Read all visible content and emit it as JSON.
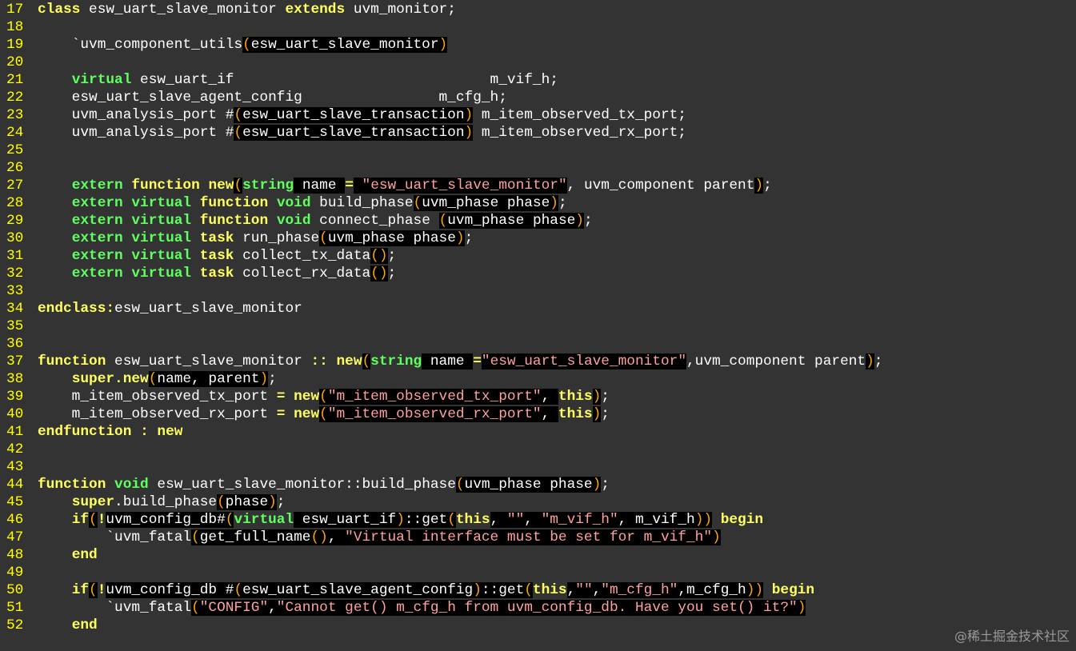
{
  "editor": {
    "lines": [
      {
        "n": "17",
        "tokens": [
          [
            "kw-y",
            "class"
          ],
          [
            "plain",
            " esw_uart_slave_monitor "
          ],
          [
            "kw-y",
            "extends"
          ],
          [
            "plain",
            " uvm_monitor;"
          ]
        ]
      },
      {
        "n": "18",
        "tokens": []
      },
      {
        "n": "19",
        "tokens": [
          [
            "plain",
            "    `uvm_component_utils"
          ],
          [
            "paren",
            "("
          ],
          [
            "dark",
            "esw_uart_slave_monitor"
          ],
          [
            "paren",
            ")"
          ]
        ]
      },
      {
        "n": "20",
        "tokens": []
      },
      {
        "n": "21",
        "tokens": [
          [
            "plain",
            "    "
          ],
          [
            "kw-g",
            "virtual"
          ],
          [
            "plain",
            " esw_uart_if                              m_vif_h;"
          ]
        ]
      },
      {
        "n": "22",
        "tokens": [
          [
            "plain",
            "    esw_uart_slave_agent_config                m_cfg_h;"
          ]
        ]
      },
      {
        "n": "23",
        "tokens": [
          [
            "plain",
            "    uvm_analysis_port #"
          ],
          [
            "paren",
            "("
          ],
          [
            "dark",
            "esw_uart_slave_transaction"
          ],
          [
            "paren",
            ")"
          ],
          [
            "plain",
            " m_item_observed_tx_port;"
          ]
        ]
      },
      {
        "n": "24",
        "tokens": [
          [
            "plain",
            "    uvm_analysis_port #"
          ],
          [
            "paren",
            "("
          ],
          [
            "dark",
            "esw_uart_slave_transaction"
          ],
          [
            "paren",
            ")"
          ],
          [
            "plain",
            " m_item_observed_rx_port;"
          ]
        ]
      },
      {
        "n": "25",
        "tokens": []
      },
      {
        "n": "26",
        "tokens": []
      },
      {
        "n": "27",
        "tokens": [
          [
            "plain",
            "    "
          ],
          [
            "kw-g",
            "extern"
          ],
          [
            "plain",
            " "
          ],
          [
            "kw-y",
            "function"
          ],
          [
            "plain",
            " "
          ],
          [
            "kw-y",
            "new"
          ],
          [
            "paren",
            "("
          ],
          [
            "kw-g",
            "string"
          ],
          [
            "dark",
            " name "
          ],
          [
            "op",
            "="
          ],
          [
            "dark",
            " "
          ],
          [
            "str",
            "\"esw_uart_slave_monitor\""
          ],
          [
            "plain",
            ", uvm_component parent"
          ],
          [
            "paren",
            ")"
          ],
          [
            "plain",
            ";"
          ]
        ]
      },
      {
        "n": "28",
        "tokens": [
          [
            "plain",
            "    "
          ],
          [
            "kw-g",
            "extern"
          ],
          [
            "plain",
            " "
          ],
          [
            "kw-g",
            "virtual"
          ],
          [
            "plain",
            " "
          ],
          [
            "kw-y",
            "function"
          ],
          [
            "plain",
            " "
          ],
          [
            "kw-g",
            "void"
          ],
          [
            "plain",
            " build_phase"
          ],
          [
            "paren",
            "("
          ],
          [
            "dark",
            "uvm_phase phase"
          ],
          [
            "paren",
            ")"
          ],
          [
            "plain",
            ";"
          ]
        ]
      },
      {
        "n": "29",
        "tokens": [
          [
            "plain",
            "    "
          ],
          [
            "kw-g",
            "extern"
          ],
          [
            "plain",
            " "
          ],
          [
            "kw-g",
            "virtual"
          ],
          [
            "plain",
            " "
          ],
          [
            "kw-y",
            "function"
          ],
          [
            "plain",
            " "
          ],
          [
            "kw-g",
            "void"
          ],
          [
            "plain",
            " connect_phase "
          ],
          [
            "paren",
            "("
          ],
          [
            "dark",
            "uvm_phase phase"
          ],
          [
            "paren",
            ")"
          ],
          [
            "plain",
            ";"
          ]
        ]
      },
      {
        "n": "30",
        "tokens": [
          [
            "plain",
            "    "
          ],
          [
            "kw-g",
            "extern"
          ],
          [
            "plain",
            " "
          ],
          [
            "kw-g",
            "virtual"
          ],
          [
            "plain",
            " "
          ],
          [
            "kw-y",
            "task"
          ],
          [
            "plain",
            " run_phase"
          ],
          [
            "paren",
            "("
          ],
          [
            "dark",
            "uvm_phase phase"
          ],
          [
            "paren",
            ")"
          ],
          [
            "plain",
            ";"
          ]
        ]
      },
      {
        "n": "31",
        "tokens": [
          [
            "plain",
            "    "
          ],
          [
            "kw-g",
            "extern"
          ],
          [
            "plain",
            " "
          ],
          [
            "kw-g",
            "virtual"
          ],
          [
            "plain",
            " "
          ],
          [
            "kw-y",
            "task"
          ],
          [
            "plain",
            " collect_tx_data"
          ],
          [
            "paren",
            "()"
          ],
          [
            "plain",
            ";"
          ]
        ]
      },
      {
        "n": "32",
        "tokens": [
          [
            "plain",
            "    "
          ],
          [
            "kw-g",
            "extern"
          ],
          [
            "plain",
            " "
          ],
          [
            "kw-g",
            "virtual"
          ],
          [
            "plain",
            " "
          ],
          [
            "kw-y",
            "task"
          ],
          [
            "plain",
            " collect_rx_data"
          ],
          [
            "paren",
            "()"
          ],
          [
            "plain",
            ";"
          ]
        ]
      },
      {
        "n": "33",
        "tokens": []
      },
      {
        "n": "34",
        "tokens": [
          [
            "kw-y",
            "endclass"
          ],
          [
            "op",
            ":"
          ],
          [
            "plain",
            "esw_uart_slave_monitor"
          ]
        ]
      },
      {
        "n": "35",
        "tokens": []
      },
      {
        "n": "36",
        "tokens": []
      },
      {
        "n": "37",
        "tokens": [
          [
            "kw-y",
            "function"
          ],
          [
            "plain",
            " esw_uart_slave_monitor "
          ],
          [
            "op",
            "::"
          ],
          [
            "plain",
            " "
          ],
          [
            "kw-y",
            "new"
          ],
          [
            "paren",
            "("
          ],
          [
            "kw-g",
            "string"
          ],
          [
            "dark",
            " name "
          ],
          [
            "op",
            "="
          ],
          [
            "str",
            "\"esw_uart_slave_monitor\""
          ],
          [
            "plain",
            ",uvm_component parent"
          ],
          [
            "paren",
            ")"
          ],
          [
            "plain",
            ";"
          ]
        ]
      },
      {
        "n": "38",
        "tokens": [
          [
            "plain",
            "    "
          ],
          [
            "kw-y",
            "super"
          ],
          [
            "op",
            "."
          ],
          [
            "kw-y",
            "new"
          ],
          [
            "paren",
            "("
          ],
          [
            "dark",
            "name, parent"
          ],
          [
            "paren",
            ")"
          ],
          [
            "plain",
            ";"
          ]
        ]
      },
      {
        "n": "39",
        "tokens": [
          [
            "plain",
            "    m_item_observed_tx_port "
          ],
          [
            "op",
            "="
          ],
          [
            "plain",
            " "
          ],
          [
            "kw-y",
            "new"
          ],
          [
            "paren",
            "("
          ],
          [
            "str",
            "\"m_item_observed_tx_port\""
          ],
          [
            "dark",
            ", "
          ],
          [
            "kw-y",
            "this"
          ],
          [
            "paren",
            ")"
          ],
          [
            "plain",
            ";"
          ]
        ]
      },
      {
        "n": "40",
        "tokens": [
          [
            "plain",
            "    m_item_observed_rx_port "
          ],
          [
            "op",
            "="
          ],
          [
            "plain",
            " "
          ],
          [
            "kw-y",
            "new"
          ],
          [
            "paren",
            "("
          ],
          [
            "str",
            "\"m_item_observed_rx_port\""
          ],
          [
            "dark",
            ", "
          ],
          [
            "kw-y",
            "this"
          ],
          [
            "paren",
            ")"
          ],
          [
            "plain",
            ";"
          ]
        ]
      },
      {
        "n": "41",
        "tokens": [
          [
            "kw-y",
            "endfunction"
          ],
          [
            "plain",
            " "
          ],
          [
            "op",
            ":"
          ],
          [
            "plain",
            " "
          ],
          [
            "kw-y",
            "new"
          ]
        ]
      },
      {
        "n": "42",
        "tokens": []
      },
      {
        "n": "43",
        "tokens": []
      },
      {
        "n": "44",
        "tokens": [
          [
            "kw-y",
            "function"
          ],
          [
            "plain",
            " "
          ],
          [
            "kw-g",
            "void"
          ],
          [
            "plain",
            " esw_uart_slave_monitor::build_phase"
          ],
          [
            "paren",
            "("
          ],
          [
            "dark",
            "uvm_phase phase"
          ],
          [
            "paren",
            ")"
          ],
          [
            "plain",
            ";"
          ]
        ]
      },
      {
        "n": "45",
        "tokens": [
          [
            "plain",
            "    "
          ],
          [
            "kw-y",
            "super"
          ],
          [
            "plain",
            ".build_phase"
          ],
          [
            "paren",
            "("
          ],
          [
            "dark",
            "phase"
          ],
          [
            "paren",
            ")"
          ],
          [
            "plain",
            ";"
          ]
        ]
      },
      {
        "n": "46",
        "tokens": [
          [
            "plain",
            "    "
          ],
          [
            "kw-y",
            "if"
          ],
          [
            "paren",
            "("
          ],
          [
            "kw-y",
            "!"
          ],
          [
            "dark",
            "uvm_config_db#"
          ],
          [
            "paren",
            "("
          ],
          [
            "kw-g",
            "virtual"
          ],
          [
            "dark",
            " esw_uart_if"
          ],
          [
            "paren",
            ")"
          ],
          [
            "dark",
            "::get"
          ],
          [
            "paren",
            "("
          ],
          [
            "kw-y",
            "this"
          ],
          [
            "dark",
            ", "
          ],
          [
            "str",
            "\"\""
          ],
          [
            "dark",
            ", "
          ],
          [
            "str",
            "\"m_vif_h\""
          ],
          [
            "dark",
            ", m_vif_h"
          ],
          [
            "paren",
            "))"
          ],
          [
            "plain",
            " "
          ],
          [
            "kw-y",
            "begin"
          ]
        ]
      },
      {
        "n": "47",
        "tokens": [
          [
            "plain",
            "        `uvm_fatal"
          ],
          [
            "paren",
            "("
          ],
          [
            "dark",
            "get_full_name"
          ],
          [
            "paren",
            "()"
          ],
          [
            "dark",
            ", "
          ],
          [
            "str",
            "\"Virtual interface must be set for m_vif_h\""
          ],
          [
            "paren",
            ")"
          ]
        ]
      },
      {
        "n": "48",
        "tokens": [
          [
            "plain",
            "    "
          ],
          [
            "kw-y",
            "end"
          ]
        ]
      },
      {
        "n": "49",
        "tokens": []
      },
      {
        "n": "50",
        "tokens": [
          [
            "plain",
            "    "
          ],
          [
            "kw-y",
            "if"
          ],
          [
            "paren",
            "("
          ],
          [
            "kw-y",
            "!"
          ],
          [
            "dark",
            "uvm_config_db #"
          ],
          [
            "paren",
            "("
          ],
          [
            "dark",
            "esw_uart_slave_agent_config"
          ],
          [
            "paren",
            ")"
          ],
          [
            "dark",
            "::get"
          ],
          [
            "paren",
            "("
          ],
          [
            "kw-y",
            "this"
          ],
          [
            "dark",
            ","
          ],
          [
            "str",
            "\"\""
          ],
          [
            "dark",
            ","
          ],
          [
            "str",
            "\"m_cfg_h\""
          ],
          [
            "dark",
            ",m_cfg_h"
          ],
          [
            "paren",
            "))"
          ],
          [
            "plain",
            " "
          ],
          [
            "kw-y",
            "begin"
          ]
        ]
      },
      {
        "n": "51",
        "tokens": [
          [
            "plain",
            "        `uvm_fatal"
          ],
          [
            "paren",
            "("
          ],
          [
            "str",
            "\"CONFIG\""
          ],
          [
            "dark",
            ","
          ],
          [
            "str",
            "\"Cannot get() m_cfg_h from uvm_config_db. Have you set() it?\""
          ],
          [
            "paren",
            ")"
          ]
        ]
      },
      {
        "n": "52",
        "tokens": [
          [
            "plain",
            "    "
          ],
          [
            "kw-y",
            "end"
          ]
        ]
      }
    ]
  },
  "watermark": "@稀土掘金技术社区"
}
